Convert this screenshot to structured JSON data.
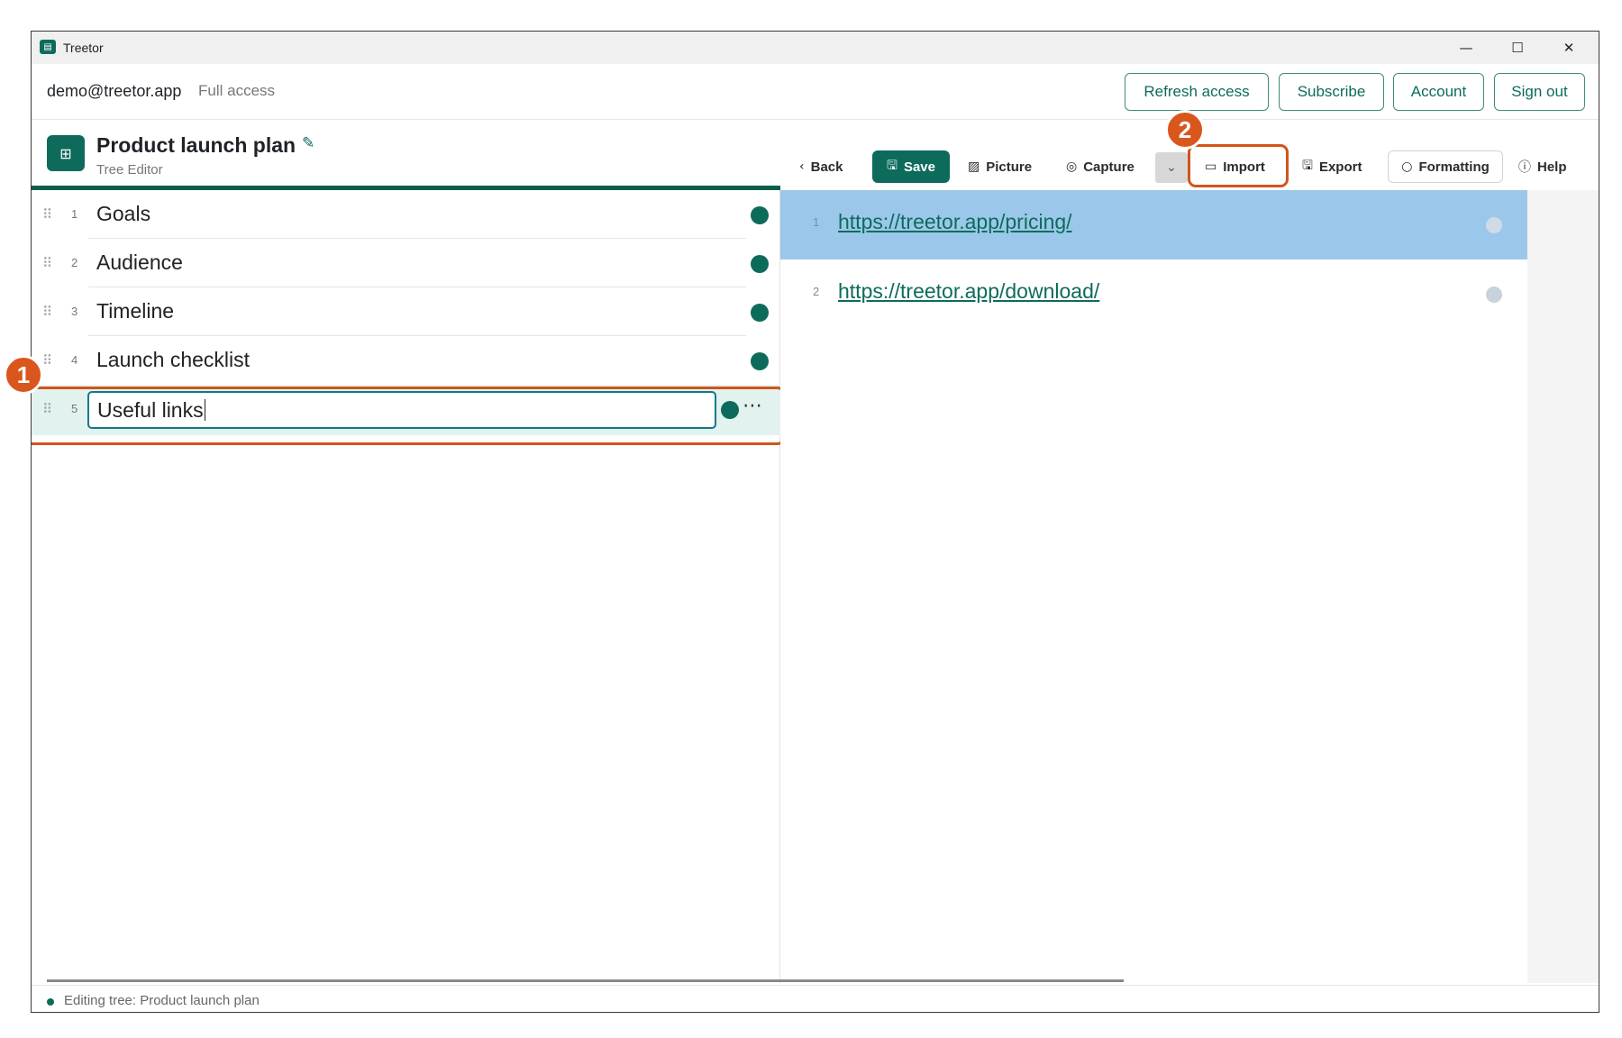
{
  "window": {
    "title": "Treetor",
    "controls": {
      "minimize": "—",
      "maximize": "☐",
      "close": "✕"
    }
  },
  "account": {
    "email": "demo@treetor.app",
    "access": "Full access",
    "buttons": {
      "refresh": "Refresh access",
      "subscribe": "Subscribe",
      "account": "Account",
      "signout": "Sign out"
    }
  },
  "editor": {
    "icon_glyph": "⊞",
    "title": "Product launch plan",
    "subtitle": "Tree Editor"
  },
  "toolbar": {
    "back": "Back",
    "save": "Save",
    "picture": "Picture",
    "capture": "Capture",
    "import": "Import",
    "export": "Export",
    "formatting": "Formatting",
    "help": "Help"
  },
  "tree": {
    "items": [
      {
        "num": "1",
        "label": "Goals"
      },
      {
        "num": "2",
        "label": "Audience"
      },
      {
        "num": "3",
        "label": "Timeline"
      },
      {
        "num": "4",
        "label": "Launch checklist"
      }
    ],
    "editing": {
      "num": "5",
      "value": "Useful links"
    }
  },
  "links": [
    {
      "num": "1",
      "url": "https://treetor.app/pricing/"
    },
    {
      "num": "2",
      "url": "https://treetor.app/download/"
    }
  ],
  "status": {
    "text": "Editing tree: Product launch plan"
  },
  "callouts": {
    "one": "1",
    "two": "2"
  },
  "colors": {
    "accent": "#0d6b5c",
    "highlight": "#d2541a",
    "selected_row": "#9bc8ea"
  }
}
